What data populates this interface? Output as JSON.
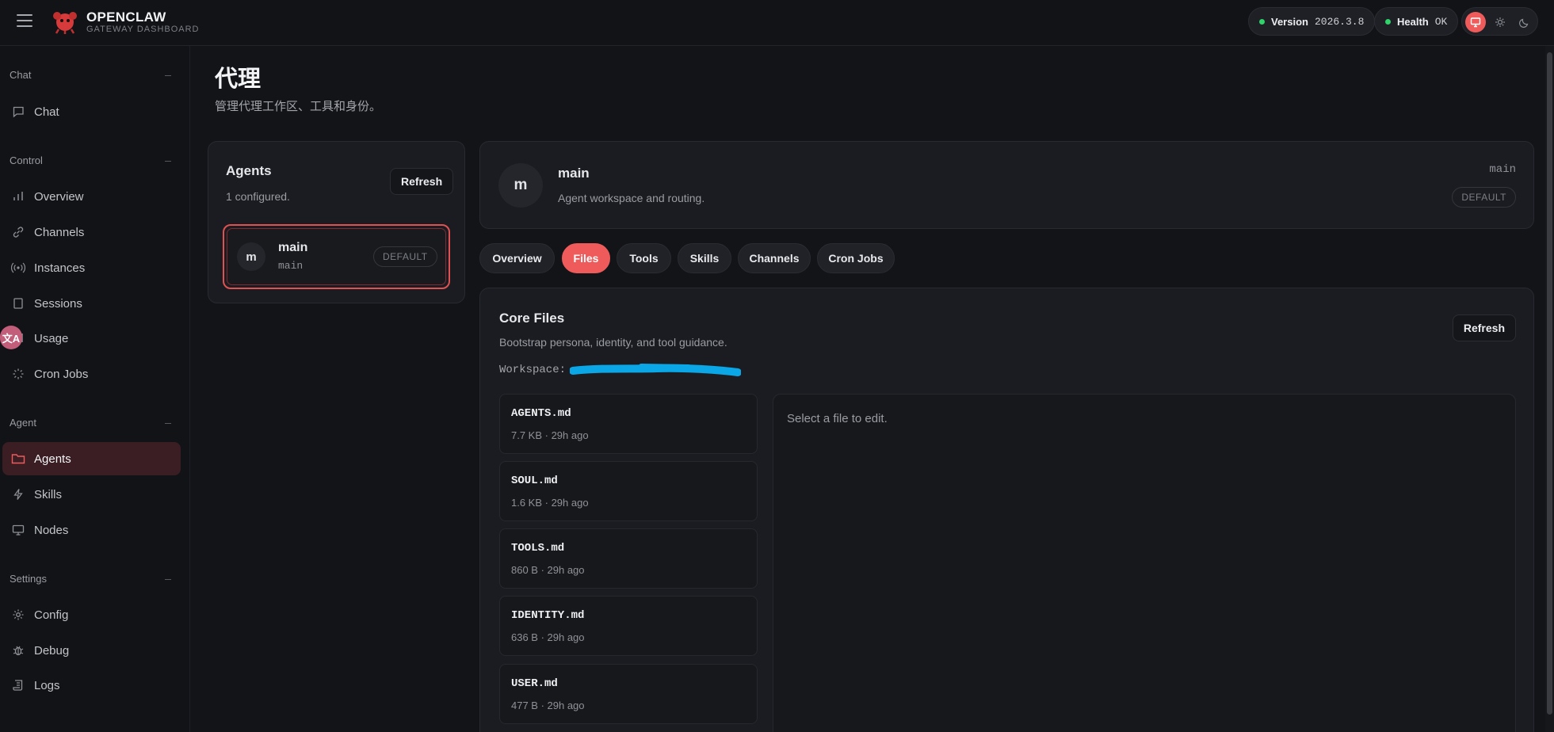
{
  "brand": {
    "title": "OPENCLAW",
    "subtitle": "GATEWAY DASHBOARD"
  },
  "status": {
    "version_label": "Version",
    "version_value": "2026.3.8",
    "health_label": "Health",
    "health_value": "OK"
  },
  "sidebar": {
    "sections": [
      {
        "label": "Chat",
        "items": [
          {
            "label": "Chat",
            "icon": "message-icon"
          }
        ]
      },
      {
        "label": "Control",
        "items": [
          {
            "label": "Overview",
            "icon": "bar-chart-icon"
          },
          {
            "label": "Channels",
            "icon": "link-icon"
          },
          {
            "label": "Instances",
            "icon": "broadcast-icon"
          },
          {
            "label": "Sessions",
            "icon": "document-icon"
          },
          {
            "label": "Usage",
            "icon": "bar-chart-icon"
          },
          {
            "label": "Cron Jobs",
            "icon": "spinner-icon"
          }
        ]
      },
      {
        "label": "Agent",
        "items": [
          {
            "label": "Agents",
            "icon": "folder-icon",
            "active": true
          },
          {
            "label": "Skills",
            "icon": "lightning-icon"
          },
          {
            "label": "Nodes",
            "icon": "monitor-icon"
          }
        ]
      },
      {
        "label": "Settings",
        "items": [
          {
            "label": "Config",
            "icon": "gear-icon"
          },
          {
            "label": "Debug",
            "icon": "bug-icon"
          },
          {
            "label": "Logs",
            "icon": "scroll-icon"
          }
        ]
      }
    ],
    "translate_badge": "文A"
  },
  "page": {
    "title": "代理",
    "subtitle": "管理代理工作区、工具和身份。"
  },
  "agents_panel": {
    "title": "Agents",
    "count": "1 configured.",
    "refresh_label": "Refresh",
    "items": [
      {
        "avatar": "m",
        "name": "main",
        "id": "main",
        "badge": "DEFAULT"
      }
    ]
  },
  "agent_header": {
    "avatar": "m",
    "name": "main",
    "description": "Agent workspace and routing.",
    "id": "main",
    "badge": "DEFAULT"
  },
  "tabs": [
    {
      "label": "Overview"
    },
    {
      "label": "Files",
      "active": true
    },
    {
      "label": "Tools"
    },
    {
      "label": "Skills"
    },
    {
      "label": "Channels"
    },
    {
      "label": "Cron Jobs"
    }
  ],
  "core_files": {
    "title": "Core Files",
    "description": "Bootstrap persona, identity, and tool guidance.",
    "workspace_label": "Workspace:",
    "refresh_label": "Refresh",
    "empty_editor": "Select a file to edit.",
    "files": [
      {
        "name": "AGENTS.md",
        "meta": "7.7 KB · 29h ago"
      },
      {
        "name": "SOUL.md",
        "meta": "1.6 KB · 29h ago"
      },
      {
        "name": "TOOLS.md",
        "meta": "860 B · 29h ago"
      },
      {
        "name": "IDENTITY.md",
        "meta": "636 B · 29h ago"
      },
      {
        "name": "USER.md",
        "meta": "477 B · 29h ago"
      }
    ]
  },
  "colors": {
    "accent": "#ef5b5b",
    "health_ok": "#2fd36a",
    "redaction": "#0ba6e6"
  }
}
